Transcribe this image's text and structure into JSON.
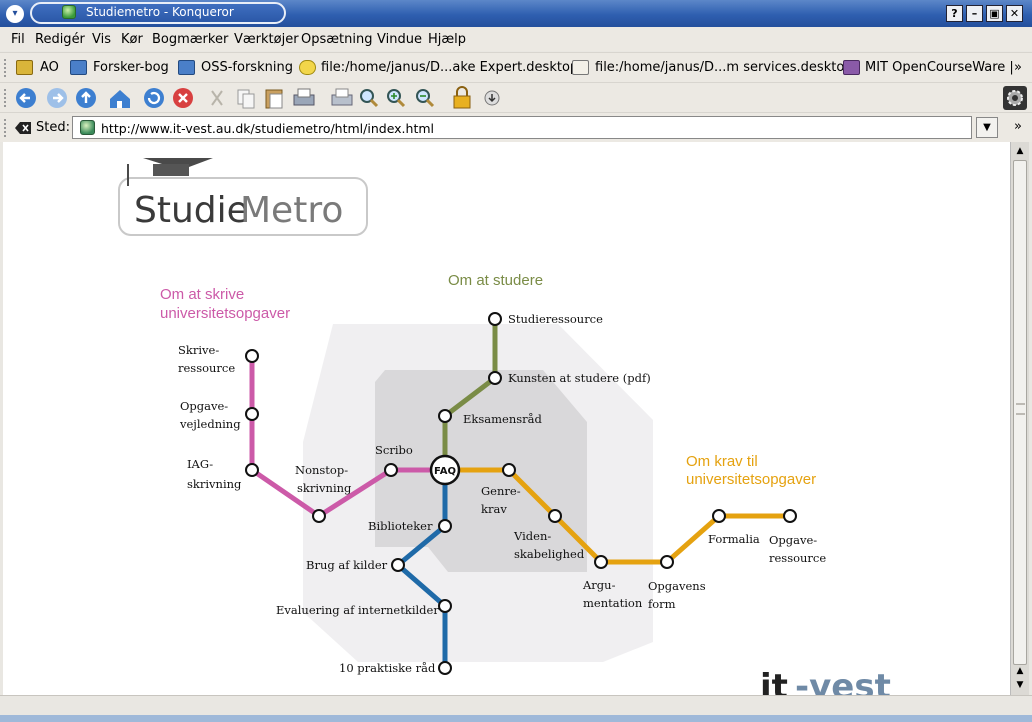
{
  "window": {
    "title": "Studiemetro - Konqueror",
    "menu_button_glyph": "▾",
    "buttons": {
      "help": "?",
      "minimize": "–",
      "maximize": "▣",
      "close": "✕"
    }
  },
  "menu": [
    "Fil",
    "Redigér",
    "Vis",
    "Kør",
    "Bogmærker",
    "Værktøjer",
    "Opsætning",
    "Vindue",
    "Hjælp"
  ],
  "bookmarks": {
    "items": [
      "AO",
      "Forsker-bog",
      "OSS-forskning",
      "file:/home/janus/D...ake Expert.desktop",
      "file:/home/janus/D...m services.desktop",
      "MIT OpenCourseWare |"
    ],
    "more": "»"
  },
  "location": {
    "label": "Sted:",
    "url": "http://www.it-vest.au.dk/studiemetro/html/index.html",
    "more": "»"
  },
  "page": {
    "logo": {
      "studie": "Studie",
      "metro": "Metro"
    },
    "sections": {
      "write_line1": "Om at skrive",
      "write_line2": "universitetsopgaver",
      "study": "Om at studere",
      "demands_line1": "Om krav til",
      "demands_line2": "universitetsopgaver"
    },
    "hub": "FAQ",
    "stations": {
      "skrive1": "Skrive-",
      "skrive2": "ressource",
      "opgave1": "Opgave-",
      "opgave2": "vejledning",
      "iag1": "IAG-",
      "iag2": "skrivning",
      "nonstop1": "Nonstop-",
      "nonstop2": "skrivning",
      "scribo": "Scribo",
      "studieressource": "Studieressource",
      "kunsten": "Kunsten at studere (pdf)",
      "eksamensraad": "Eksamensråd",
      "genre1": "Genre-",
      "genre2": "krav",
      "viden1": "Viden-",
      "viden2": "skabelighed",
      "argu1": "Argu-",
      "argu2": "mentation",
      "form1": "Opgavens",
      "form2": "form",
      "formalia": "Formalia",
      "opgressource1": "Opgave-",
      "opgressource2": "ressource",
      "biblioteker": "Biblioteker",
      "kilder": "Brug af kilder",
      "internet": "Evaluering af internetkilder",
      "praktiske": "10 praktiske råd"
    },
    "footer_logo": {
      "it": "it",
      "vest": "-vest"
    }
  },
  "colors": {
    "write_line": "#cc5aa8",
    "study_line": "#7a8c46",
    "demands_line": "#e5a210",
    "library_line": "#1f6aa8",
    "write_title": "#cc5aa8",
    "study_title": "#7a8c46",
    "demands_title": "#e5a210"
  },
  "icons": [
    "back-icon",
    "forward-icon",
    "up-icon",
    "home-icon",
    "reload-icon",
    "stop-icon",
    "cut-icon",
    "copy-icon",
    "paste-icon",
    "print-icon",
    "print-frame-icon",
    "zoom-icon",
    "zoom-in-icon",
    "zoom-out-icon",
    "security-lock-icon",
    "download-icon",
    "konqueror-gear-icon"
  ]
}
